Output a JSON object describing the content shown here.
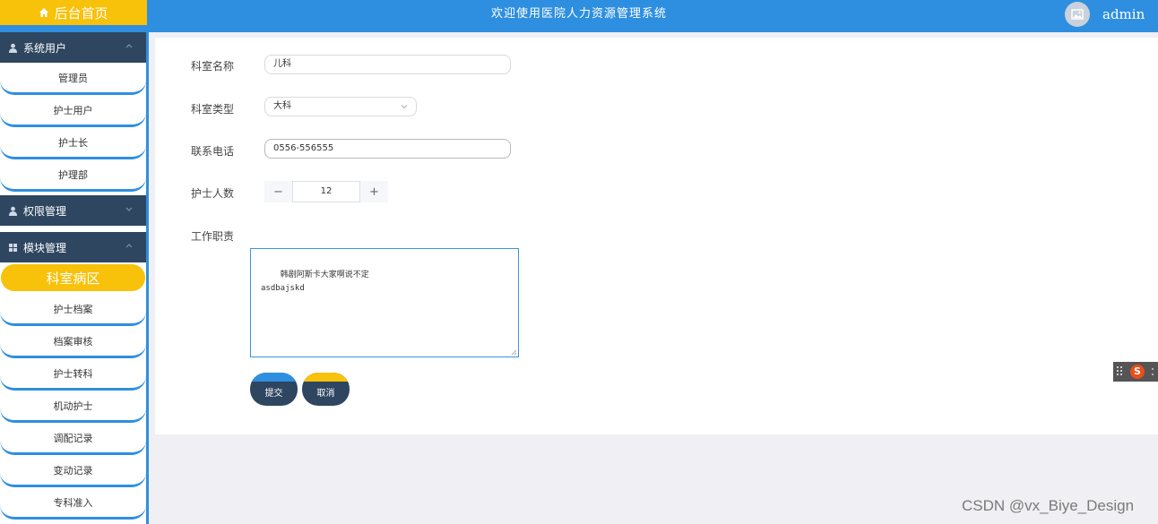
{
  "header": {
    "home_label": "后台首页",
    "title": "欢迎使用医院人力资源管理系统",
    "username": "admin"
  },
  "sidebar": {
    "groups": [
      {
        "label": "系统用户",
        "icon": "user-icon",
        "expanded": true,
        "items": [
          "管理员",
          "护士用户",
          "护士长",
          "护理部"
        ]
      },
      {
        "label": "权限管理",
        "icon": "user-icon",
        "expanded": false,
        "items": []
      },
      {
        "label": "模块管理",
        "icon": "grid-icon",
        "expanded": true,
        "items": [
          "科室病区",
          "护士档案",
          "档案审核",
          "护士转科",
          "机动护士",
          "调配记录",
          "变动记录",
          "专科准入"
        ]
      }
    ],
    "active_item": "科室病区"
  },
  "form": {
    "dept_name_label": "科室名称",
    "dept_name_value": "儿科",
    "dept_type_label": "科室类型",
    "dept_type_value": "大科",
    "phone_label": "联系电话",
    "phone_value": "0556-556555",
    "nurse_count_label": "护士人数",
    "nurse_count_value": "12",
    "minus": "−",
    "plus": "+",
    "duties_label": "工作职责",
    "duties_value": "韩剧阿斯卡大家啊说不定\nasdbajskd",
    "submit_label": "提交",
    "cancel_label": "取消"
  },
  "colors": {
    "primary": "#2e8fe0",
    "accent": "#f8c10a",
    "dark": "#2e4660"
  },
  "watermark": "CSDN @vx_Biye_Design"
}
